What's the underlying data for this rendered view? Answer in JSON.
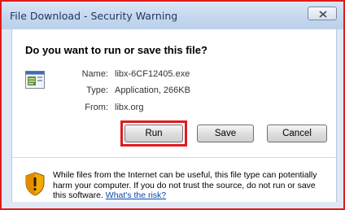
{
  "window": {
    "title": "File Download - Security Warning",
    "close_icon": "close-x-icon"
  },
  "dialog": {
    "question": "Do you want to run or save this file?",
    "file_icon": "executable-file-icon",
    "name_label": "Name:",
    "name_value": "libx-6CF12405.exe",
    "type_label": "Type:",
    "type_value": "Application, 266KB",
    "from_label": "From:",
    "from_value": "libx.org"
  },
  "buttons": {
    "run": "Run",
    "save": "Save",
    "cancel": "Cancel"
  },
  "warning": {
    "icon": "shield-warning-icon",
    "text": "While files from the Internet can be useful, this file type can potentially harm your computer. If you do not trust the source, do not run or save this software.",
    "link": "What's the risk?"
  },
  "colors": {
    "highlight": "#e11b1b",
    "link": "#0645ad"
  }
}
